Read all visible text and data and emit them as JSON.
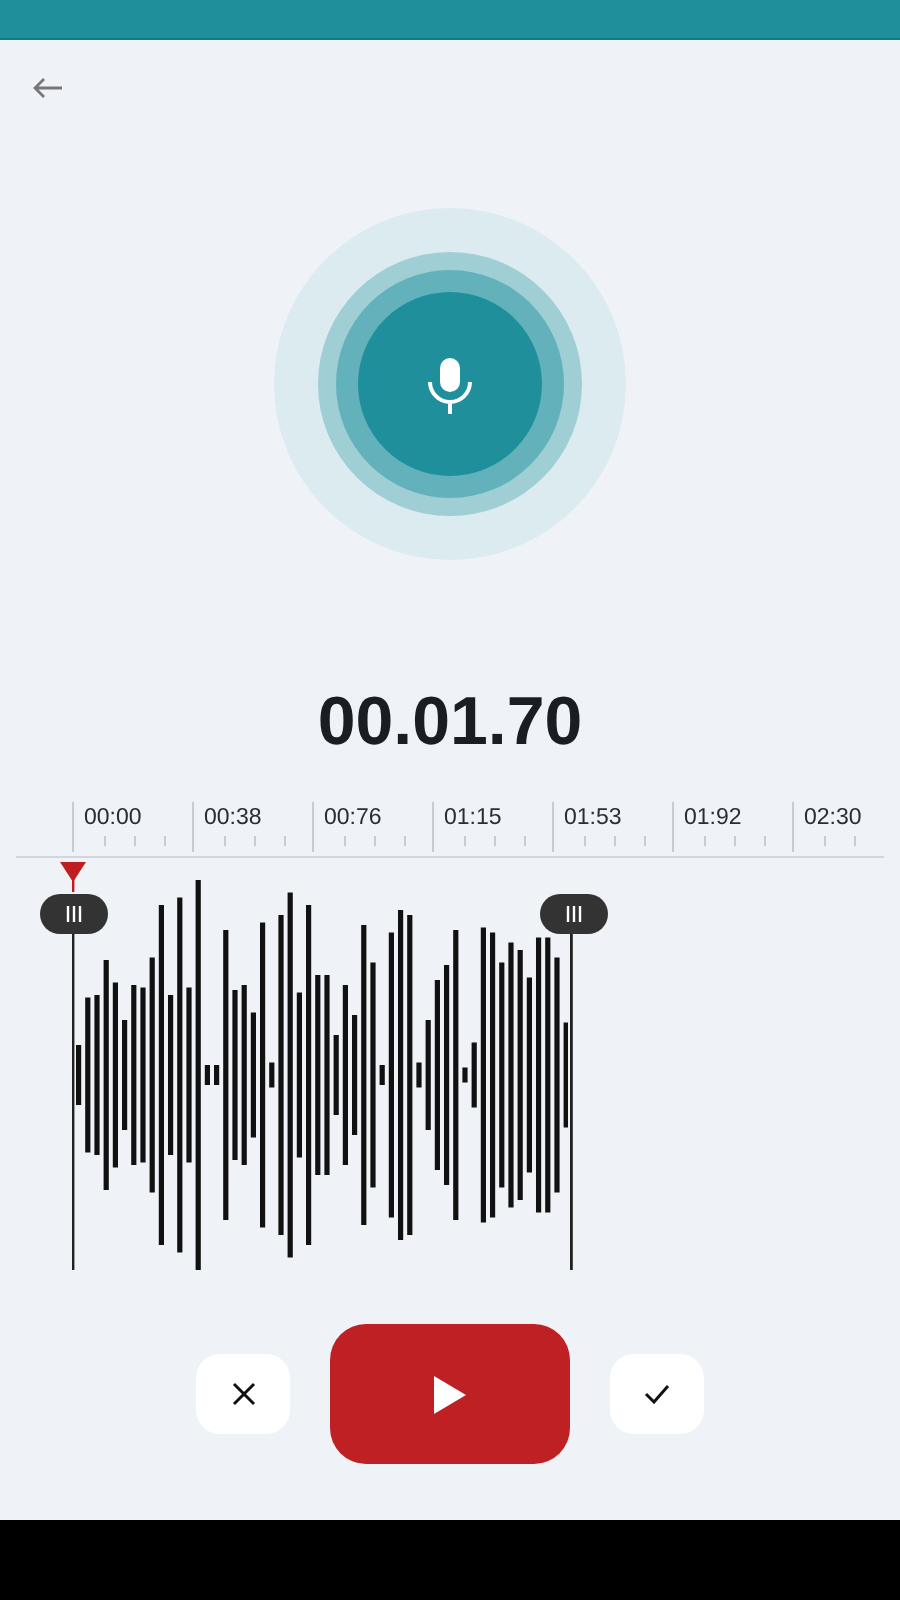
{
  "timer": "00.01.70",
  "ruler": [
    "00:00",
    "00:38",
    "00:76",
    "01:15",
    "01:53",
    "01:92",
    "02:30"
  ],
  "buttons": [
    {
      "kind": "discard"
    },
    {
      "kind": "play"
    },
    {
      "kind": "confirm"
    }
  ]
}
